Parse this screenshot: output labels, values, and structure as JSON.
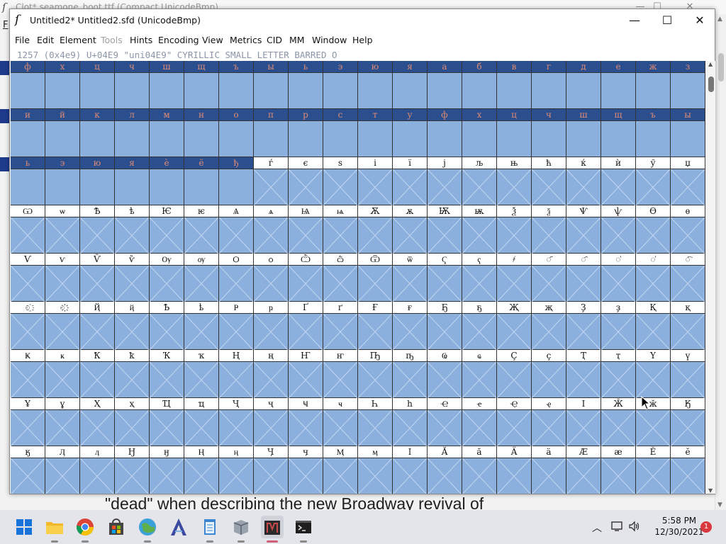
{
  "background_window": {
    "title": "Clot*  seamone_boot.ttf (Compact UnicodeBmp)",
    "menu_letter": "F",
    "overlay_text": "\"dead\" when describing the new Broadway revival of"
  },
  "window": {
    "title": "Untitled2*  Untitled2.sfd (UnicodeBmp)",
    "controls": {
      "minimize": "—",
      "maximize": "☐",
      "close": "✕"
    }
  },
  "menu": [
    {
      "label": "File",
      "enabled": true
    },
    {
      "label": "Edit",
      "enabled": true
    },
    {
      "label": "Element",
      "enabled": true
    },
    {
      "label": "Tools",
      "enabled": false
    },
    {
      "label": "Hints",
      "enabled": true
    },
    {
      "label": "Encoding",
      "enabled": true
    },
    {
      "label": "View",
      "enabled": true
    },
    {
      "label": "Metrics",
      "enabled": true
    },
    {
      "label": "CID",
      "enabled": true
    },
    {
      "label": "MM",
      "enabled": true
    },
    {
      "label": "Window",
      "enabled": true
    },
    {
      "label": "Help",
      "enabled": true
    }
  ],
  "info_line": "1257 (0x4e9) U+04E9 \"uni04E9\" CYRILLIC SMALL LETTER BARRED O",
  "grid_rows": [
    [
      "ф",
      "х",
      "ц",
      "ч",
      "ш",
      "щ",
      "ъ",
      "ы",
      "ь",
      "э",
      "ю",
      "я",
      "а",
      "б",
      "в",
      "г",
      "д",
      "е",
      "ж",
      "з"
    ],
    [
      "и",
      "й",
      "к",
      "л",
      "м",
      "н",
      "о",
      "п",
      "р",
      "с",
      "т",
      "у",
      "ф",
      "х",
      "ц",
      "ч",
      "ш",
      "щ",
      "ъ",
      "ы"
    ],
    [
      "ь",
      "э",
      "ю",
      "я",
      "è",
      "ё",
      "ђ",
      "ѓ",
      "є",
      "ѕ",
      "і",
      "ї",
      "ј",
      "љ",
      "њ",
      "ћ",
      "ќ",
      "ѝ",
      "ў",
      "џ"
    ],
    [
      "Ѡ",
      "ѡ",
      "Ѣ",
      "ѣ",
      "Ѥ",
      "ѥ",
      "Ѧ",
      "ѧ",
      "Ѩ",
      "ѩ",
      "Ѫ",
      "ѫ",
      "Ѭ",
      "ѭ",
      "Ѯ",
      "ѯ",
      "Ѱ",
      "ѱ",
      "Ѳ",
      "ѳ"
    ],
    [
      "Ѵ",
      "ѵ",
      "Ѷ",
      "ѷ",
      "Ѹ",
      "ѹ",
      "Ѻ",
      "ѻ",
      "Ѽ",
      "ѽ",
      "Ѿ",
      "ѿ",
      "Ҁ",
      "ҁ",
      "҂",
      "◌҃",
      "◌҄",
      "◌҅",
      "◌҆",
      "◌҇"
    ],
    [
      "◌҈",
      "◌҉",
      "Ҋ",
      "ҋ",
      "Ҍ",
      "ҍ",
      "Ҏ",
      "ҏ",
      "Ґ",
      "ґ",
      "Ғ",
      "ғ",
      "Ҕ",
      "ҕ",
      "Җ",
      "җ",
      "Ҙ",
      "ҙ",
      "Қ",
      "қ"
    ],
    [
      "Ҝ",
      "ҝ",
      "Ҟ",
      "ҟ",
      "Ҡ",
      "ҡ",
      "Ң",
      "ң",
      "Ҥ",
      "ҥ",
      "Ҧ",
      "ҧ",
      "Ҩ",
      "ҩ",
      "Ҫ",
      "ҫ",
      "Ҭ",
      "ҭ",
      "Ү",
      "ү"
    ],
    [
      "Ұ",
      "ұ",
      "Ҳ",
      "ҳ",
      "Ҵ",
      "ҵ",
      "Ҷ",
      "ҷ",
      "Ҹ",
      "ҹ",
      "Һ",
      "һ",
      "Ҽ",
      "ҽ",
      "Ҿ",
      "ҿ",
      "Ӏ",
      "Ӂ",
      "ӂ",
      "Ӄ"
    ],
    [
      "ӄ",
      "Ӆ",
      "ӆ",
      "Ӈ",
      "ӈ",
      "Ӊ",
      "ӊ",
      "Ӌ",
      "ӌ",
      "Ӎ",
      "ӎ",
      "ӏ",
      "Ӑ",
      "ӑ",
      "Ӓ",
      "ӓ",
      "Ӕ",
      "ӕ",
      "Ӗ",
      "ӗ"
    ]
  ],
  "selected_cells_per_row": [
    20,
    20,
    7,
    0,
    0,
    0,
    0,
    0,
    0
  ],
  "colors": {
    "selected_header_bg": "#2b4f8e",
    "selected_header_text": "#e08a72",
    "glyph_area": "#8cb0de"
  },
  "taskbar": {
    "apps": [
      {
        "name": "start",
        "icon": "windows-start-icon"
      },
      {
        "name": "file-explorer",
        "icon": "folder-icon"
      },
      {
        "name": "chrome",
        "icon": "chrome-icon"
      },
      {
        "name": "store",
        "icon": "store-icon"
      },
      {
        "name": "app-globe",
        "icon": "globe-app-icon"
      },
      {
        "name": "app-a",
        "icon": "a-app-icon"
      },
      {
        "name": "notepad",
        "icon": "notepad-icon"
      },
      {
        "name": "app-box",
        "icon": "box-app-icon"
      },
      {
        "name": "fontforge",
        "icon": "fontforge-icon"
      },
      {
        "name": "terminal",
        "icon": "terminal-icon"
      }
    ],
    "time": "5:58 PM",
    "date": "12/30/2021",
    "notification_count": "1"
  }
}
